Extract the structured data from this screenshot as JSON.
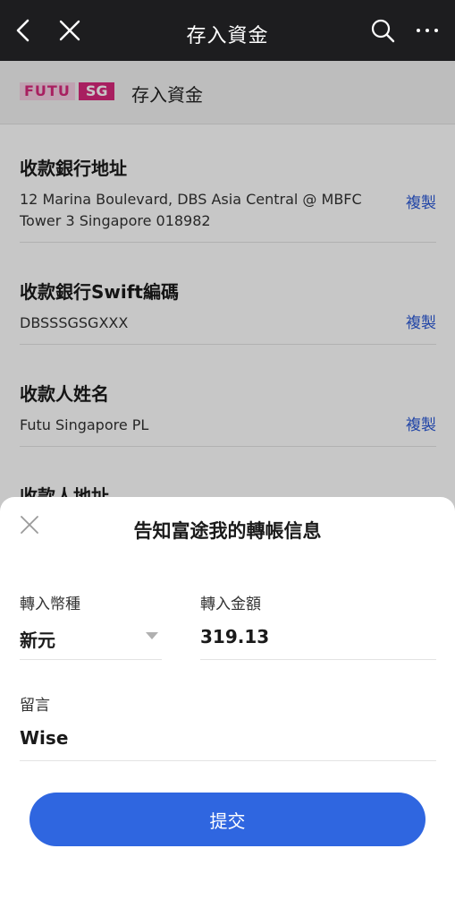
{
  "topbar": {
    "title": "存入資金",
    "back_icon": "chevron-left-icon",
    "close_icon": "close-icon",
    "search_icon": "search-icon",
    "more_icon": "more-horizontal-icon"
  },
  "brand": {
    "logo_text_1": "FUTU",
    "logo_text_2": "SG",
    "heading": "存入資金",
    "colors": {
      "brand_pink": "#d8287b",
      "brand_pink_light": "#f5d0e3"
    }
  },
  "info": {
    "copy_label": "複製",
    "items": [
      {
        "label": "收款銀行地址",
        "value": "12 Marina Boulevard, DBS Asia Central @ MBFC Tower 3 Singapore 018982"
      },
      {
        "label": "收款銀行Swift編碼",
        "value": "DBSSSGSGXXX"
      },
      {
        "label": "收款人姓名",
        "value": "Futu Singapore PL"
      },
      {
        "label": "收款人地址",
        "value": ""
      }
    ]
  },
  "sheet": {
    "title": "告知富途我的轉帳信息",
    "currency_label": "轉入幣種",
    "currency_value": "新元",
    "amount_label": "轉入金額",
    "amount_value": "319.13",
    "message_label": "留言",
    "message_value": "Wise",
    "submit_label": "提交",
    "colors": {
      "accent": "#2f66e0"
    }
  }
}
